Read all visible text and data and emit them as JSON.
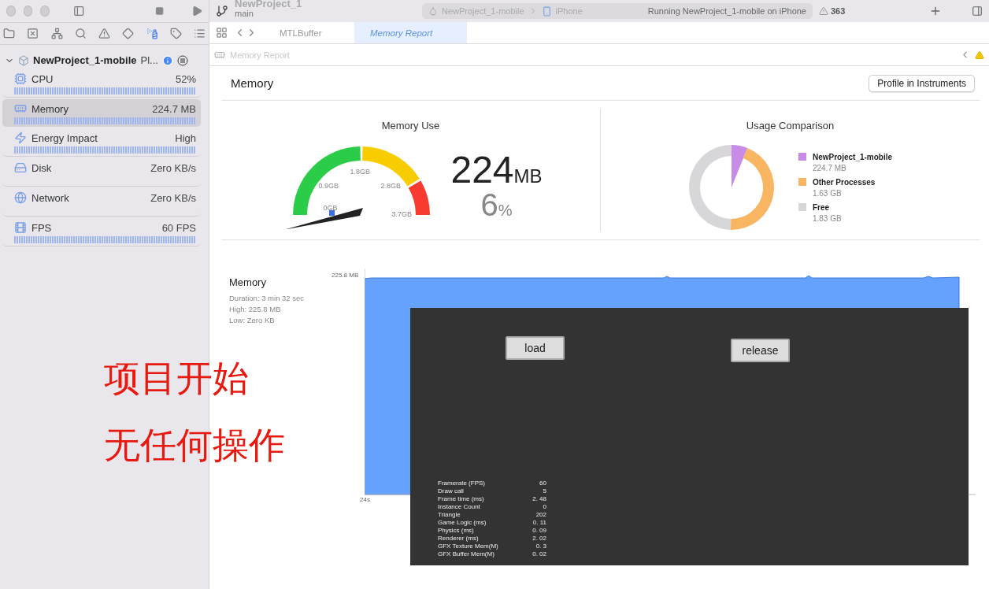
{
  "toolbar": {
    "project": "NewProject_1",
    "branch": "main",
    "scheme": "NewProject_1-mobile",
    "device": "iPhone",
    "status": "Running NewProject_1-mobile on iPhone",
    "warnings": "363"
  },
  "tabs": [
    {
      "label": "MTLBuffer",
      "selected": false
    },
    {
      "label": "Memory Report",
      "selected": true
    }
  ],
  "breadcrumb": "Memory Report",
  "navigator": {
    "process": "NewProject_1-mobile",
    "process_suffix": "Pl...",
    "items": [
      {
        "name": "CPU",
        "value": "52%",
        "selected": false,
        "graph": true
      },
      {
        "name": "Memory",
        "value": "224.7 MB",
        "selected": true,
        "graph": true
      },
      {
        "name": "Energy Impact",
        "value": "High",
        "selected": false,
        "graph": true
      },
      {
        "name": "Disk",
        "value": "Zero KB/s",
        "selected": false,
        "graph": false
      },
      {
        "name": "Network",
        "value": "Zero KB/s",
        "selected": false,
        "graph": false
      },
      {
        "name": "FPS",
        "value": "60 FPS",
        "selected": false,
        "graph": true
      }
    ]
  },
  "report": {
    "title": "Memory",
    "profile_button": "Profile in Instruments",
    "memory_use": {
      "title": "Memory Use",
      "level": 0.06,
      "ticks": [
        "0GB",
        "0.9GB",
        "1.8GB",
        "2.8GB",
        "3.7GB"
      ],
      "amount": "224",
      "amount_unit": "MB",
      "percent": "6",
      "percent_unit": "%"
    },
    "usage_comparison": {
      "title": "Usage Comparison",
      "chart_data": {
        "type": "pie",
        "categories": [
          "NewProject_1-mobile",
          "Other Processes",
          "Free"
        ],
        "values": [
          6.1,
          44.2,
          49.7
        ]
      },
      "legend": [
        {
          "value": "224.7 MB",
          "color": "#c88be8"
        },
        {
          "value": "1.63 GB",
          "color": "#f8b663"
        },
        {
          "value": "1.83 GB",
          "color": "#d7d7d9"
        }
      ]
    },
    "timeline": {
      "title": "Memory",
      "details": [
        "Duration: 3 min 32 sec",
        "High: 225.8 MB",
        "Low: Zero KB"
      ],
      "y_tick": "225.8 MB",
      "x_tick": "24s"
    }
  },
  "game_view": {
    "buttons": [
      "load",
      "release"
    ],
    "stats": [
      {
        "label": "Framerate (FPS)",
        "value": "60"
      },
      {
        "label": "Draw call",
        "value": "5"
      },
      {
        "label": "Frame time (ms)",
        "value": "2. 48"
      },
      {
        "label": "Instance Count",
        "value": "0"
      },
      {
        "label": "Triangle",
        "value": "202"
      },
      {
        "label": "Game Logic (ms)",
        "value": "0. 11"
      },
      {
        "label": "Physics (ms)",
        "value": "0. 09"
      },
      {
        "label": "Renderer (ms)",
        "value": "2. 02"
      },
      {
        "label": "GFX Texture Mem(M)",
        "value": "0. 3"
      },
      {
        "label": "GFX Buffer Mem(M)",
        "value": "0. 02"
      }
    ]
  },
  "annotations": [
    "项目开始",
    "无任何操作"
  ]
}
